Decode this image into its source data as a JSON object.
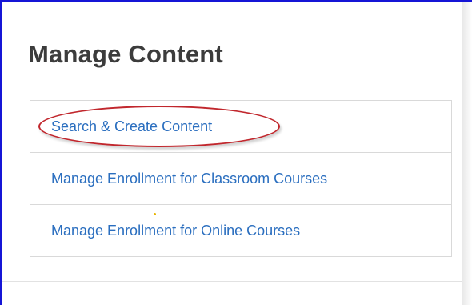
{
  "page": {
    "title": "Manage Content"
  },
  "menu": {
    "items": [
      {
        "label": "Search & Create Content",
        "highlighted": true
      },
      {
        "label": "Manage Enrollment for Classroom Courses"
      },
      {
        "label": "Manage Enrollment for Online Courses"
      }
    ]
  },
  "colors": {
    "frame_border": "#1515d6",
    "link": "#2a6ebf",
    "title": "#3c3c3c",
    "highlight": "#c1272d"
  }
}
